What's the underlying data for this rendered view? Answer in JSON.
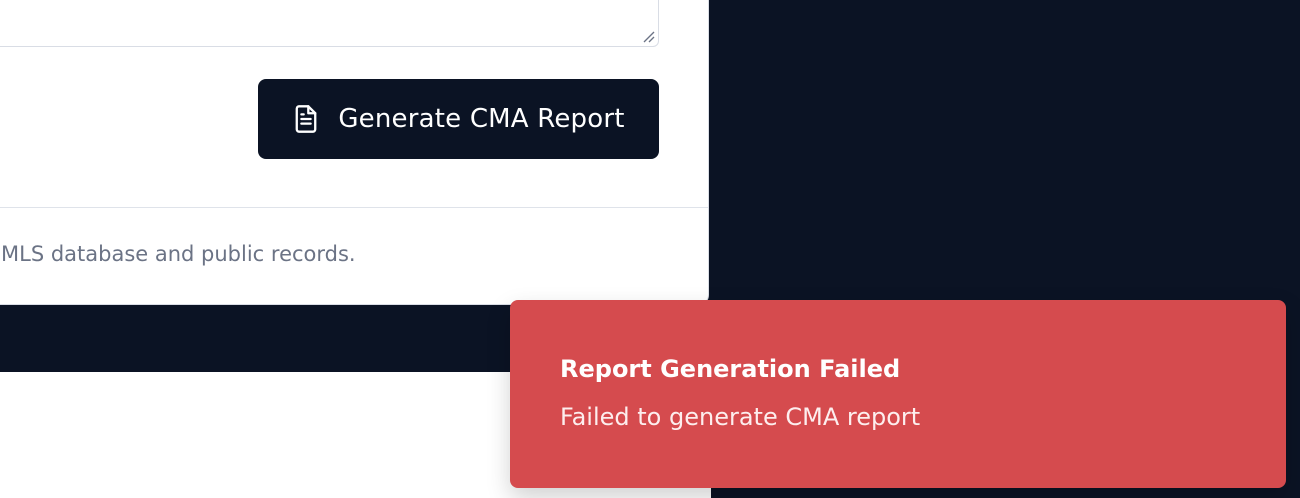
{
  "form": {
    "generate_button_label": "Generate CMA Report",
    "generate_button_icon": "document-icon"
  },
  "card": {
    "footer_text": "MLS database and public records."
  },
  "toast": {
    "title": "Report Generation Failed",
    "description": "Failed to generate CMA report",
    "color": "#d54b4e"
  },
  "colors": {
    "navy": "#0b1324",
    "muted_text": "#6b7385"
  }
}
